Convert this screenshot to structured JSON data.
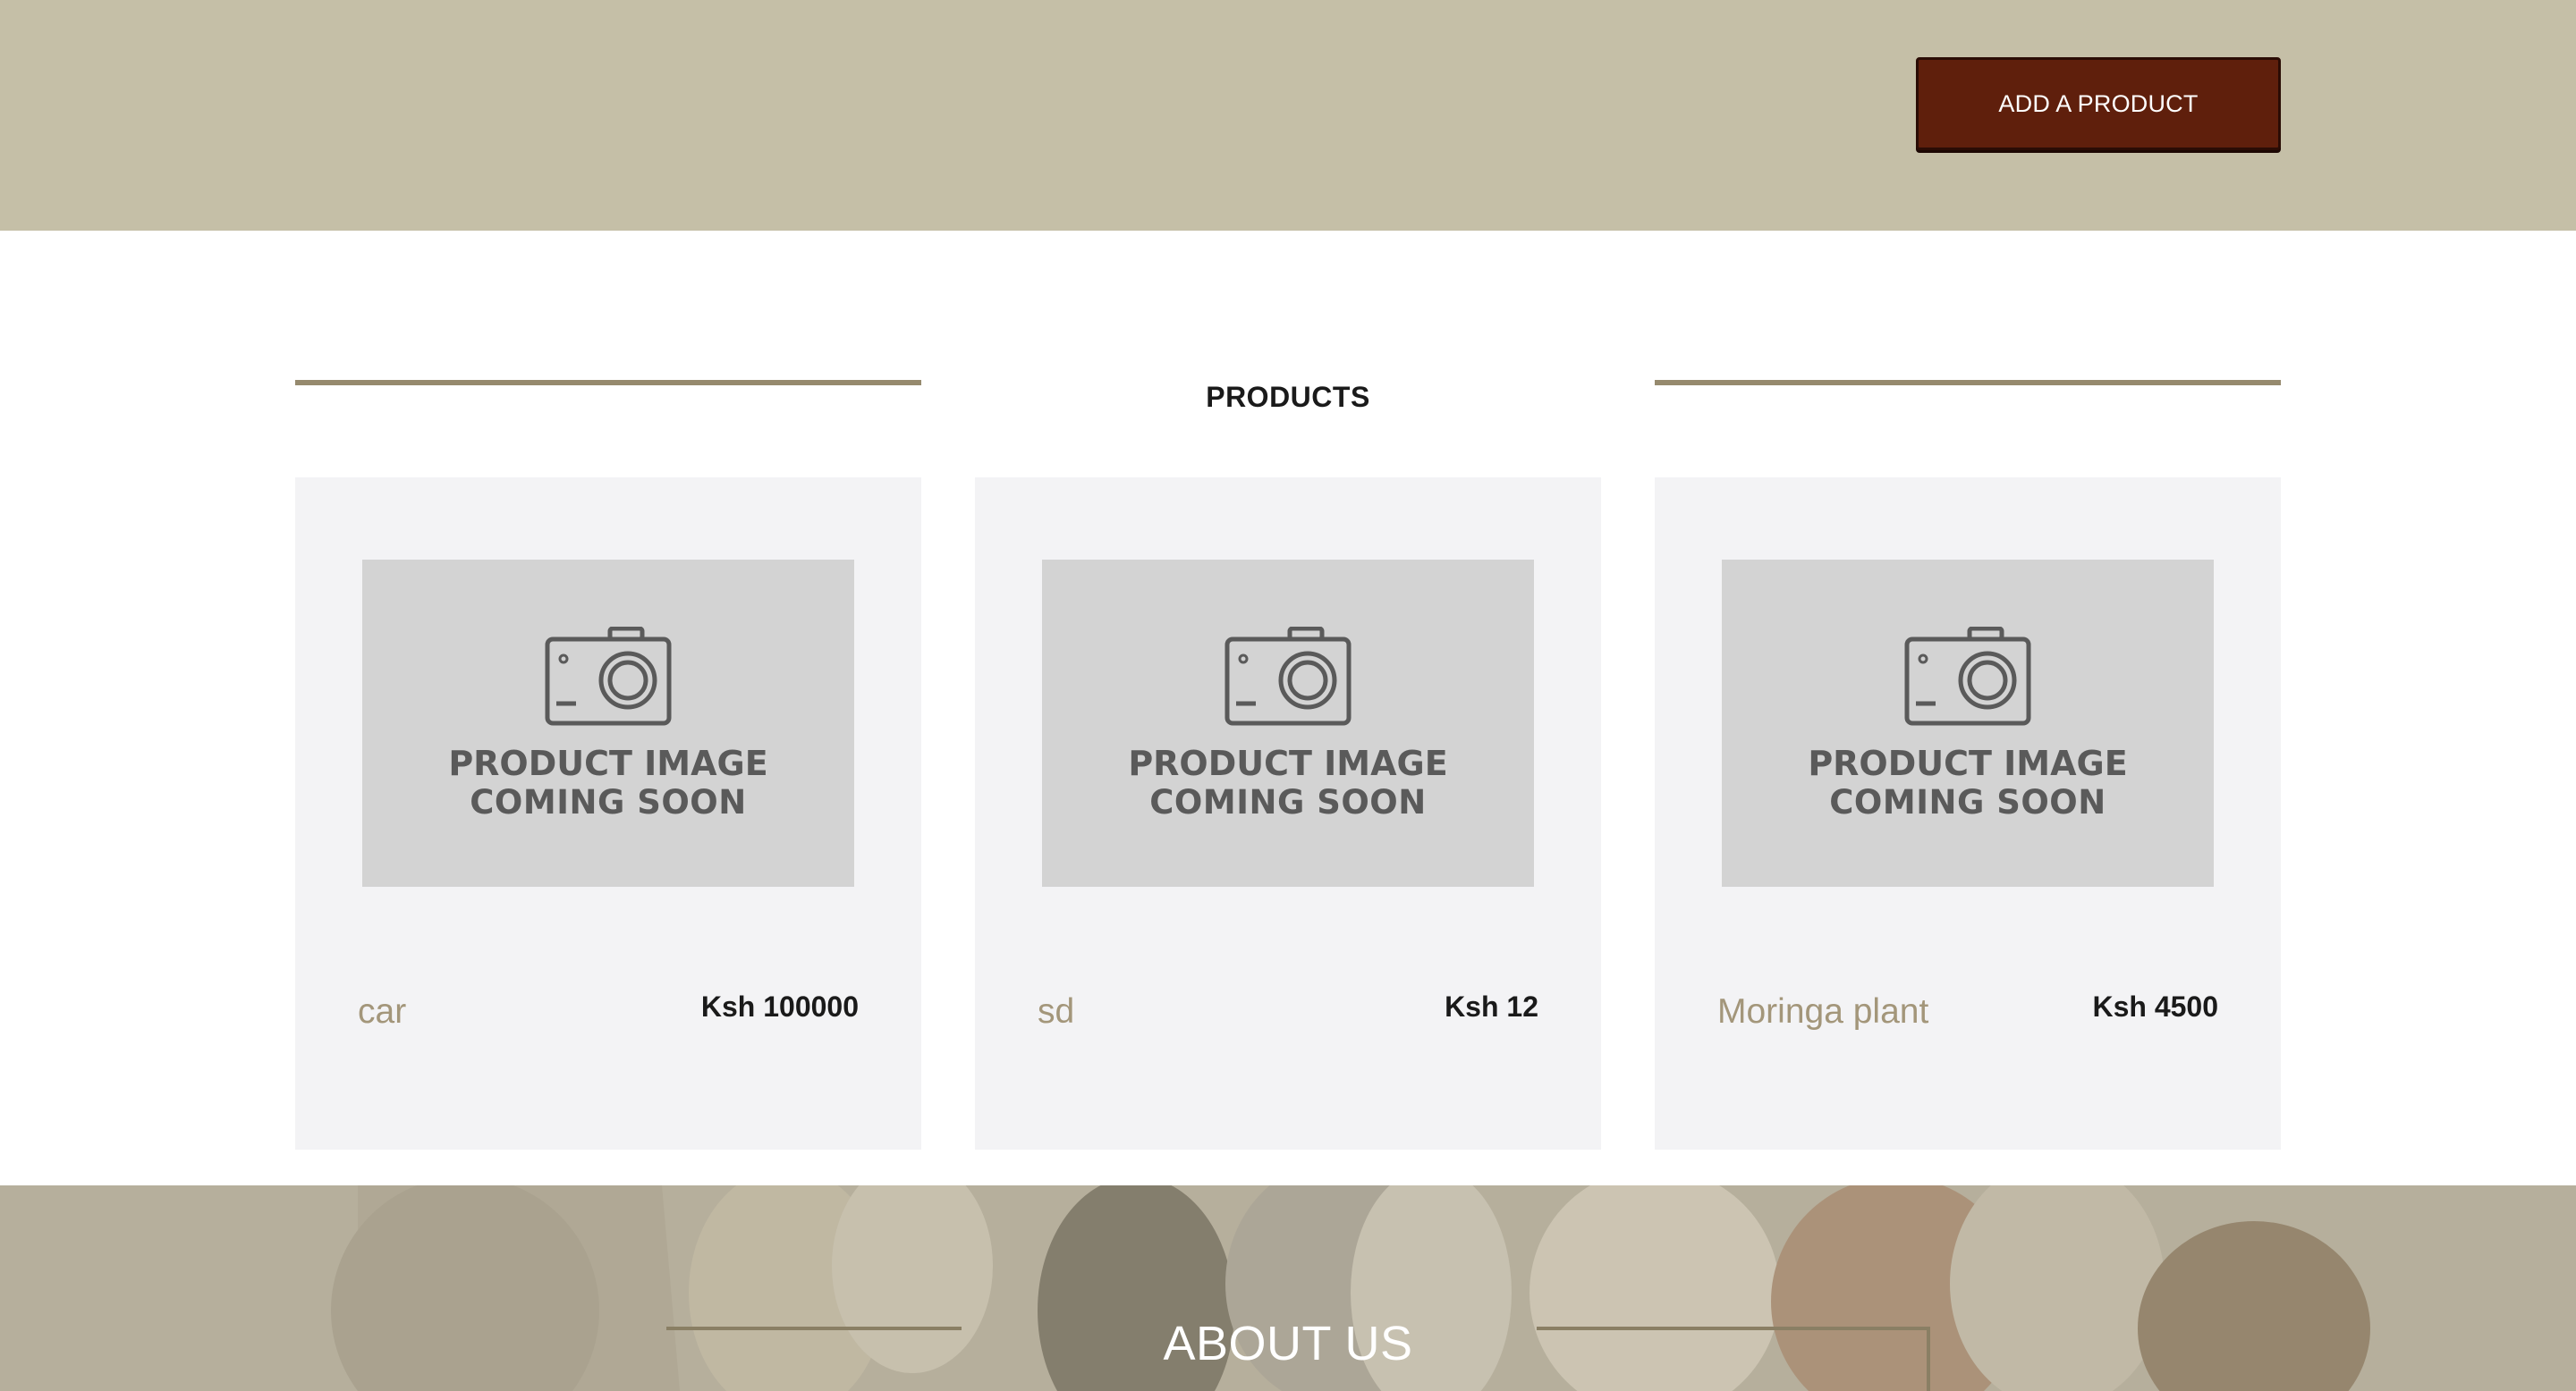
{
  "header": {
    "add_product_label": "ADD A PRODUCT",
    "background_color": "#c5bfa7",
    "button_color": "#5f1f0c"
  },
  "products_section": {
    "title": "PRODUCTS",
    "accent_color": "#968a6e",
    "placeholder_line1": "PRODUCT IMAGE",
    "placeholder_line2": "COMING SOON",
    "items": [
      {
        "name": "car",
        "price": "Ksh 100000"
      },
      {
        "name": "sd",
        "price": "Ksh 12"
      },
      {
        "name": "Moringa plant",
        "price": "Ksh 4500"
      }
    ]
  },
  "about": {
    "title": "ABOUT US"
  }
}
